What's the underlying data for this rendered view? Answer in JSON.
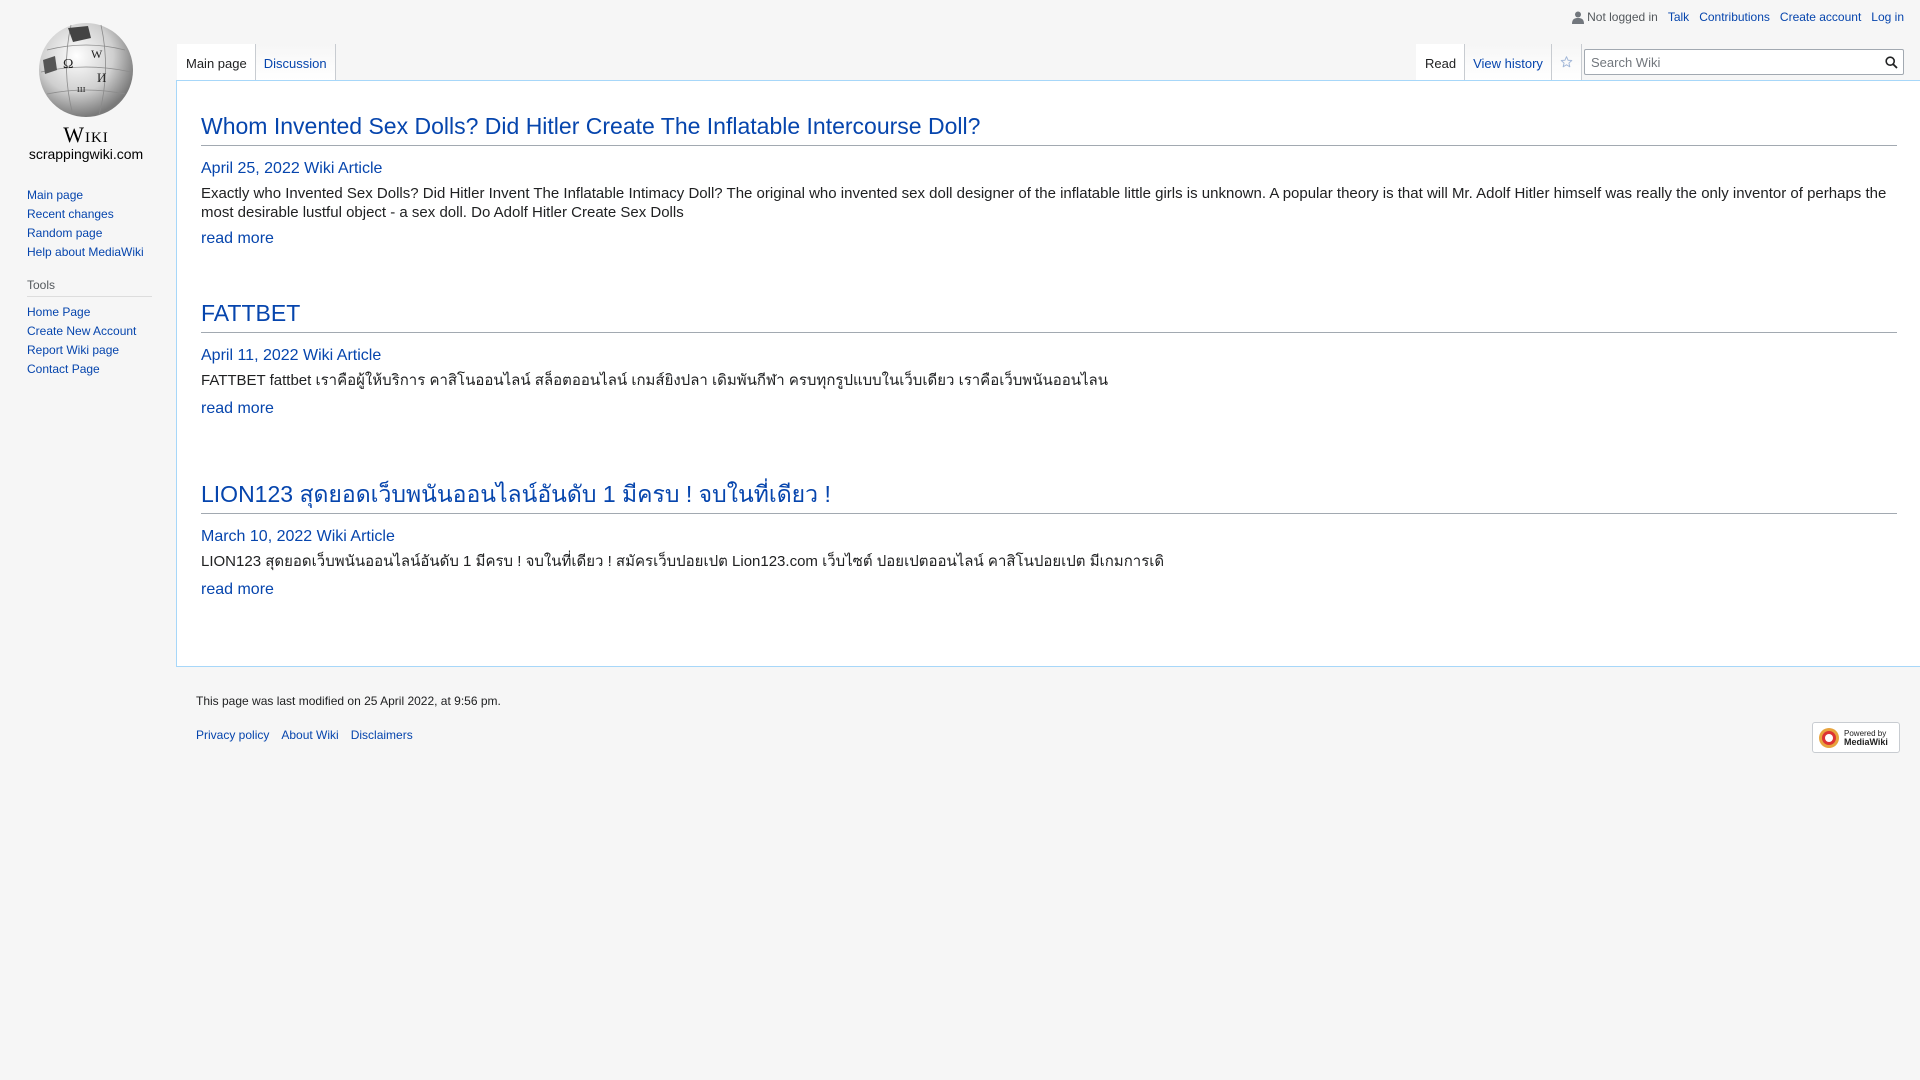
{
  "personal": {
    "status": "Not logged in",
    "links": [
      "Talk",
      "Contributions",
      "Create account",
      "Log in"
    ]
  },
  "logo": {
    "wordmark": "Wiki",
    "tagline": "scrappingwiki.com"
  },
  "sidebar": {
    "nav": [
      "Main page",
      "Recent changes",
      "Random page",
      "Help about MediaWiki"
    ],
    "tools_heading": "Tools",
    "tools": [
      "Home Page",
      "Create New Account",
      "Report Wiki page",
      "Contact Page"
    ]
  },
  "tabs": {
    "left": [
      "Main page",
      "Discussion"
    ],
    "right": [
      "Read",
      "View history"
    ],
    "watch_icon": "star-icon"
  },
  "search": {
    "placeholder": "Search Wiki",
    "icon": "search-icon"
  },
  "articles": [
    {
      "title": "Whom Invented Sex Dolls? Did Hitler Create The Inflatable Intercourse Doll?",
      "meta": "April 25, 2022 Wiki Article",
      "excerpt": "Exactly who Invented Sex Dolls? Did Hitler Invent The Inflatable Intimacy Doll? The original who invented sex doll designer of the inflatable little girls is unknown. A popular theory is that will Mr. Adolf Hitler himself was really the only inventor of perhaps the most desirable lustful object - a sex doll. Do Adolf Hitler Create Sex Dolls",
      "more": "read more"
    },
    {
      "title": "FATTBET",
      "meta": "April 11, 2022 Wiki Article",
      "excerpt": "FATTBET fattbet เราคือผู้ให้บริการ คาสิโนออนไลน์ สล็อตออนไลน์ เกมส์ยิงปลา เดิมพันกีฬา ครบทุกรูปแบบในเว็บเดียว เราคือเว็บพนันออนไลน",
      "more": "read more"
    },
    {
      "title": "LION123 สุดยอดเว็บพนันออนไลน์อันดับ 1 มีครบ ! จบในที่เดียว !",
      "meta": "March 10, 2022 Wiki Article",
      "excerpt": "LION123 สุดยอดเว็บพนันออนไลน์อันดับ 1 มีครบ ! จบในที่เดียว ! สมัครเว็บปอยเปต Lion123.com เว็บไซต์ ปอยเปตออนไลน์ คาสิโนปอยเปต มีเกมการเดิ",
      "more": "read more"
    }
  ],
  "footer": {
    "lastmod": "This page was last modified on 25 April 2022, at 9:56 pm.",
    "links": [
      "Privacy policy",
      "About Wiki",
      "Disclaimers"
    ],
    "powered_by_line1": "Powered by",
    "powered_by_line2": "MediaWiki"
  }
}
